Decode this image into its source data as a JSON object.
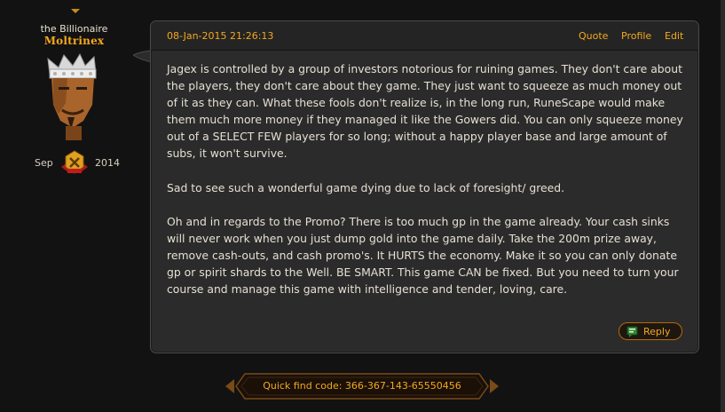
{
  "user": {
    "title": "the Billionaire",
    "name": "Moltrinex",
    "joined_month": "Sep",
    "joined_year": "2014",
    "avatar_icon": "player-avatar-icon",
    "badge_icon": "rank-badge-icon"
  },
  "post": {
    "date": "08-Jan-2015 21:26:13",
    "actions": {
      "quote": "Quote",
      "profile": "Profile",
      "edit": "Edit"
    },
    "paragraphs": [
      "Jagex is controlled by a group of investors notorious for ruining games. They don't care about the players, they don't care about they game. They just want to squeeze as much money out of it as they can. What these fools don't realize is, in the long run, RuneScape would make them much more money if they managed it like the Gowers did. You can only squeeze money out of a SELECT FEW players for so long; without a happy player base and large amount of subs, it won't survive.",
      "Sad to see such a wonderful game dying due to lack of foresight/ greed.",
      "Oh and in regards to the Promo? There is too much gp in the game already. Your cash sinks will never work when you just dump gold into the game daily. Take the 200m prize away, remove cash-outs, and cash promo's. It HURTS the economy. Make it so you can only donate gp or spirit shards to the Well. BE SMART. This game CAN be fixed. But you need to turn your course and manage this game with intelligence and tender, loving, care."
    ],
    "reply_label": "Reply",
    "reply_icon": "reply-icon"
  },
  "quick_find": {
    "label": "Quick find code: 366-367-143-65550456"
  },
  "colors": {
    "accent": "#f4a81d",
    "text": "#e6e0d4",
    "panel": "#2b2b2b",
    "background": "#121212"
  }
}
